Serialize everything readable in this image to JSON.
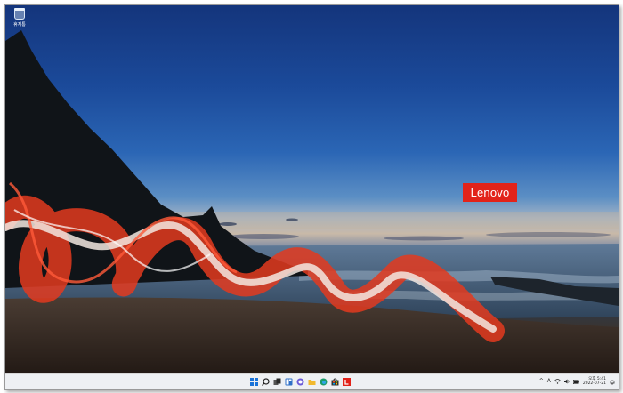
{
  "desktop": {
    "icons": [
      {
        "label": "휴지통",
        "icon": "recycle-bin-icon"
      }
    ],
    "wallpaper_logo": {
      "text": "Lenovo",
      "color": "#e2231a"
    }
  },
  "taskbar": {
    "pinned": [
      {
        "name": "start-button",
        "icon": "windows-logo-icon"
      },
      {
        "name": "search-button",
        "icon": "search-icon"
      },
      {
        "name": "task-view-button",
        "icon": "task-view-icon"
      },
      {
        "name": "widgets-button",
        "icon": "widgets-icon"
      },
      {
        "name": "chat-button",
        "icon": "chat-icon"
      },
      {
        "name": "file-explorer-button",
        "icon": "folder-icon"
      },
      {
        "name": "edge-button",
        "icon": "edge-icon"
      },
      {
        "name": "store-button",
        "icon": "store-icon"
      },
      {
        "name": "lenovo-app-button",
        "icon": "lenovo-l-icon"
      }
    ],
    "tray": {
      "chevron": "^",
      "ime": "A",
      "clock_time": "오후 5:41",
      "clock_date": "2022-07-21"
    }
  }
}
